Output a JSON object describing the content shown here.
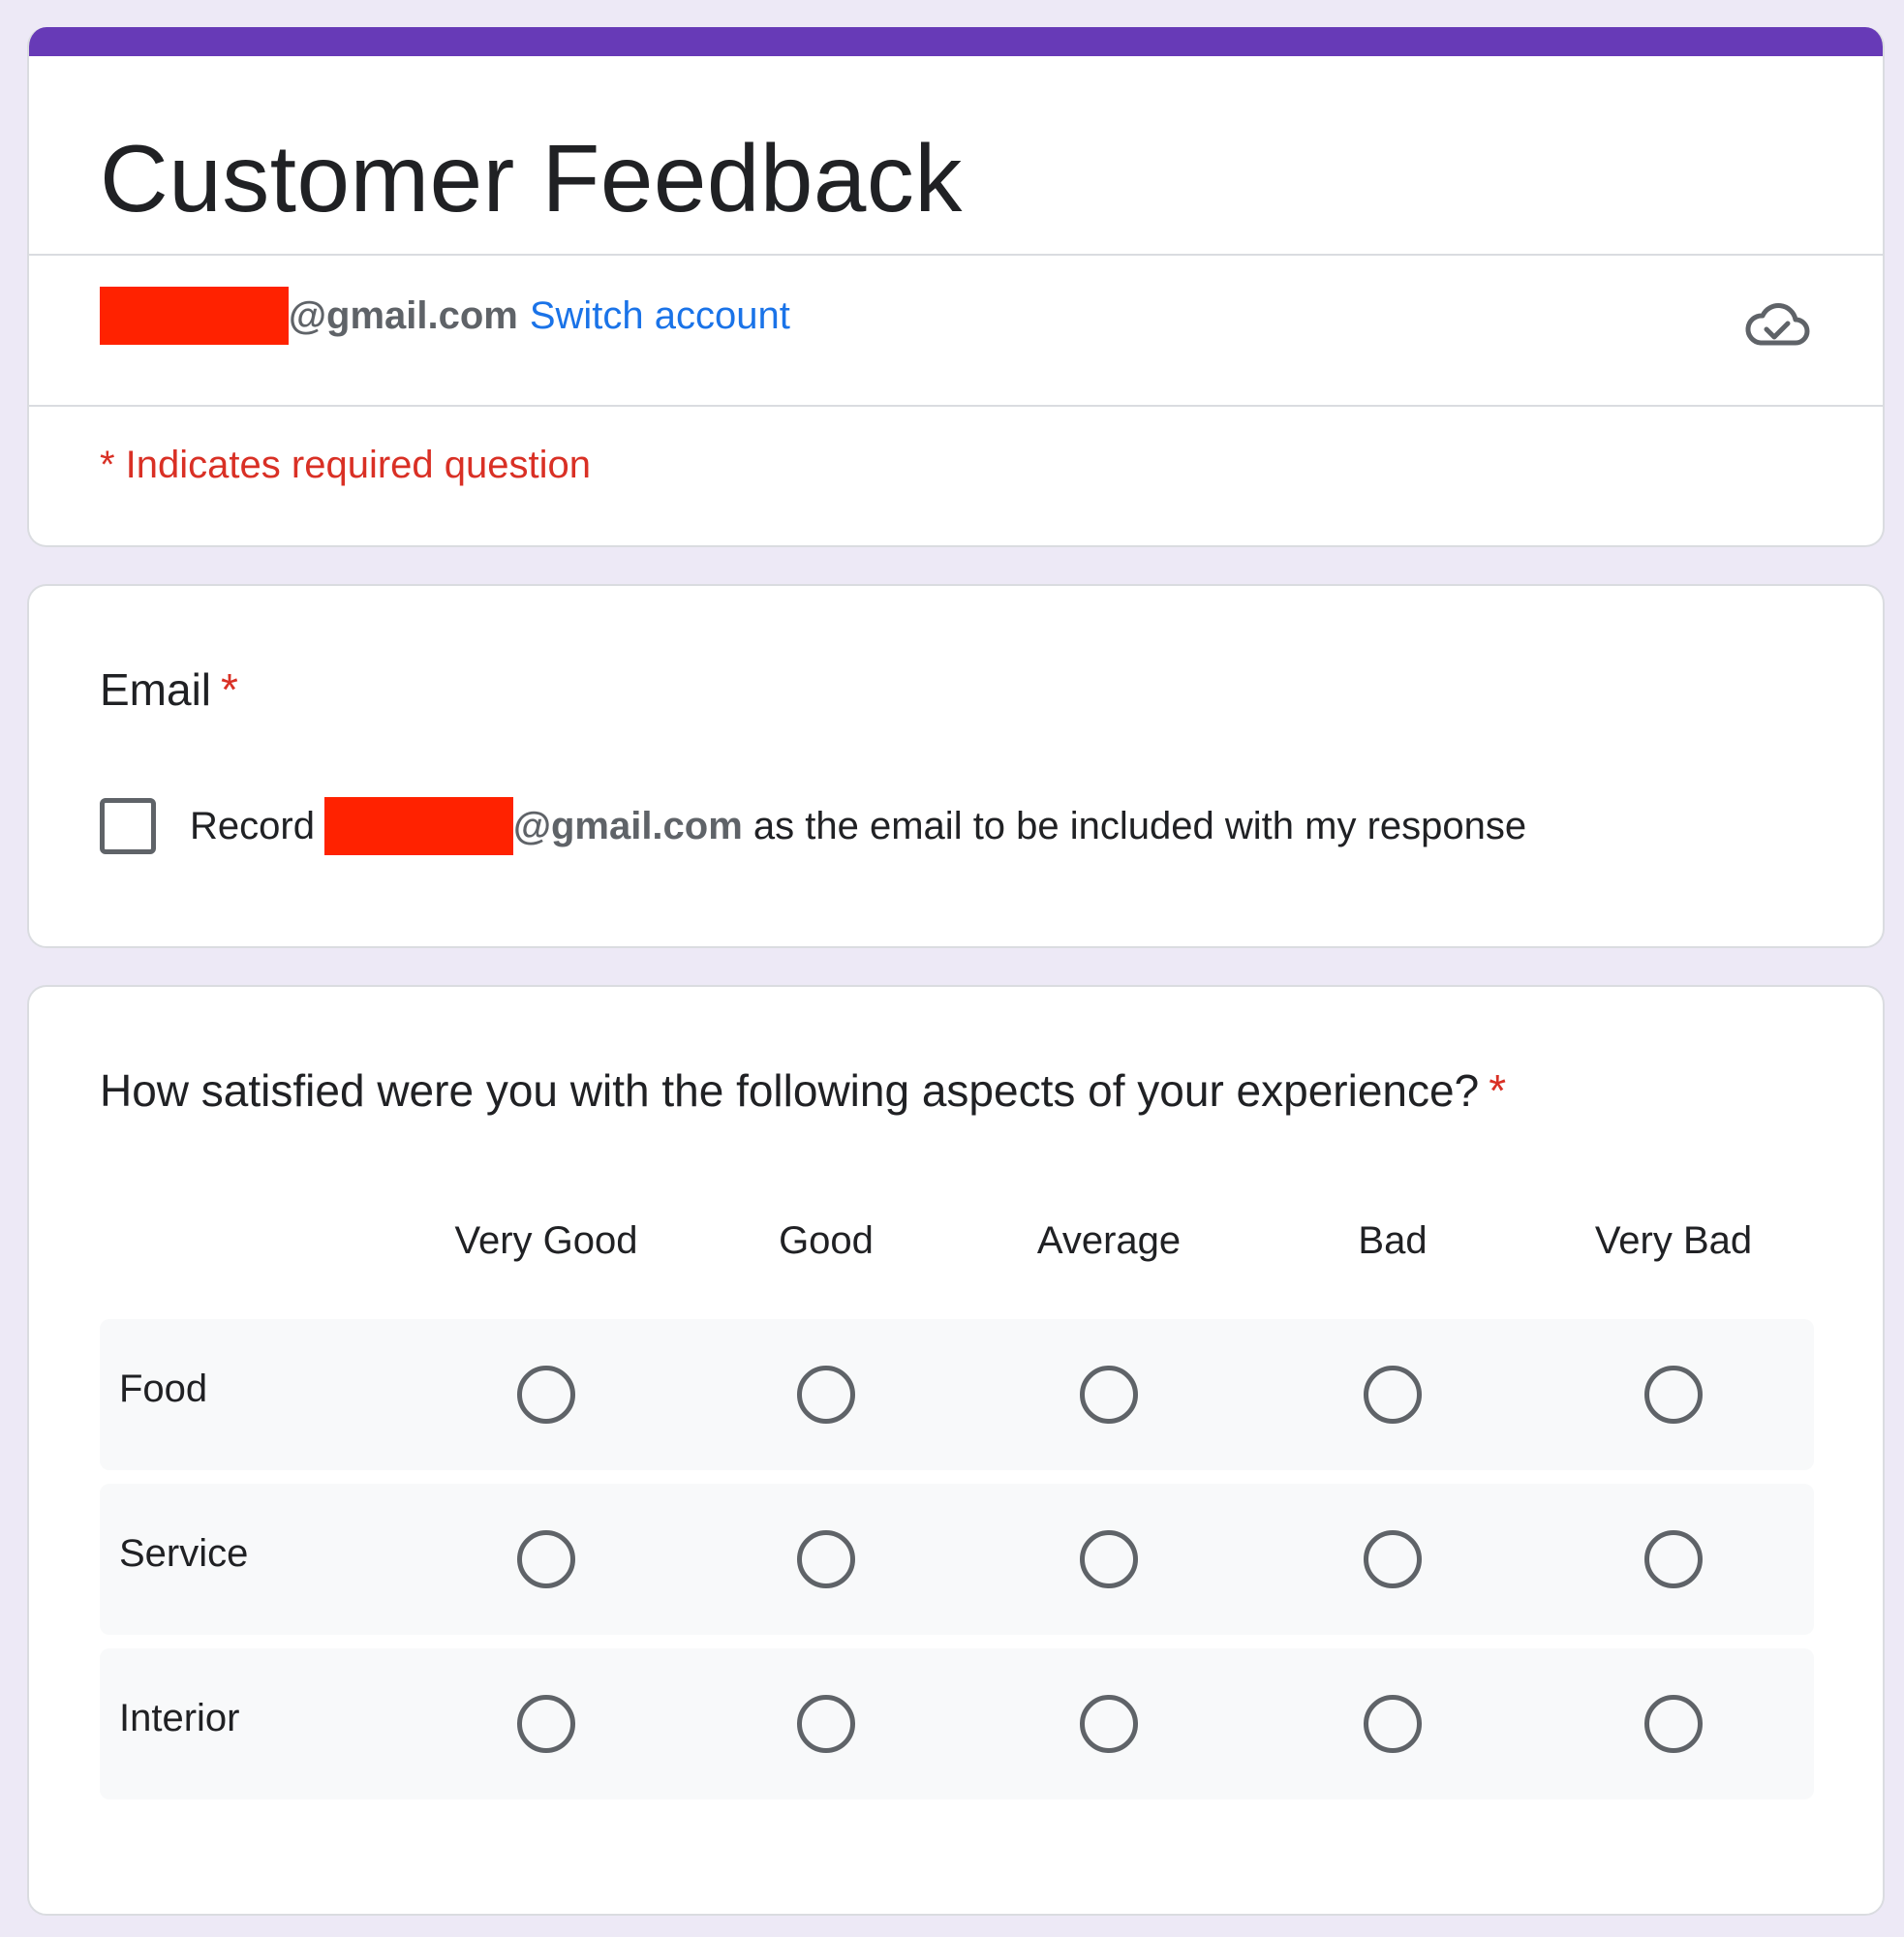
{
  "colors": {
    "accent": "#673ab7",
    "background": "#ede9f6",
    "link": "#1a73e8",
    "required": "#d93025",
    "redaction": "#ff2200"
  },
  "header": {
    "title": "Customer Feedback",
    "account_domain": "@gmail.com",
    "switch_account_label": "Switch account",
    "cloud_icon": "cloud-check-icon",
    "required_note": "* Indicates required question"
  },
  "email_question": {
    "title": "Email",
    "required_mark": "*",
    "record_prefix": "Record",
    "record_domain": "@gmail.com",
    "record_suffix": " as the email to be included with my response",
    "checked": false
  },
  "grid_question": {
    "title": "How satisfied were you with the following aspects of your experience?",
    "required_mark": "*",
    "columns": [
      "Very Good",
      "Good",
      "Average",
      "Bad",
      "Very Bad"
    ],
    "rows": [
      "Food",
      "Service",
      "Interior"
    ]
  }
}
